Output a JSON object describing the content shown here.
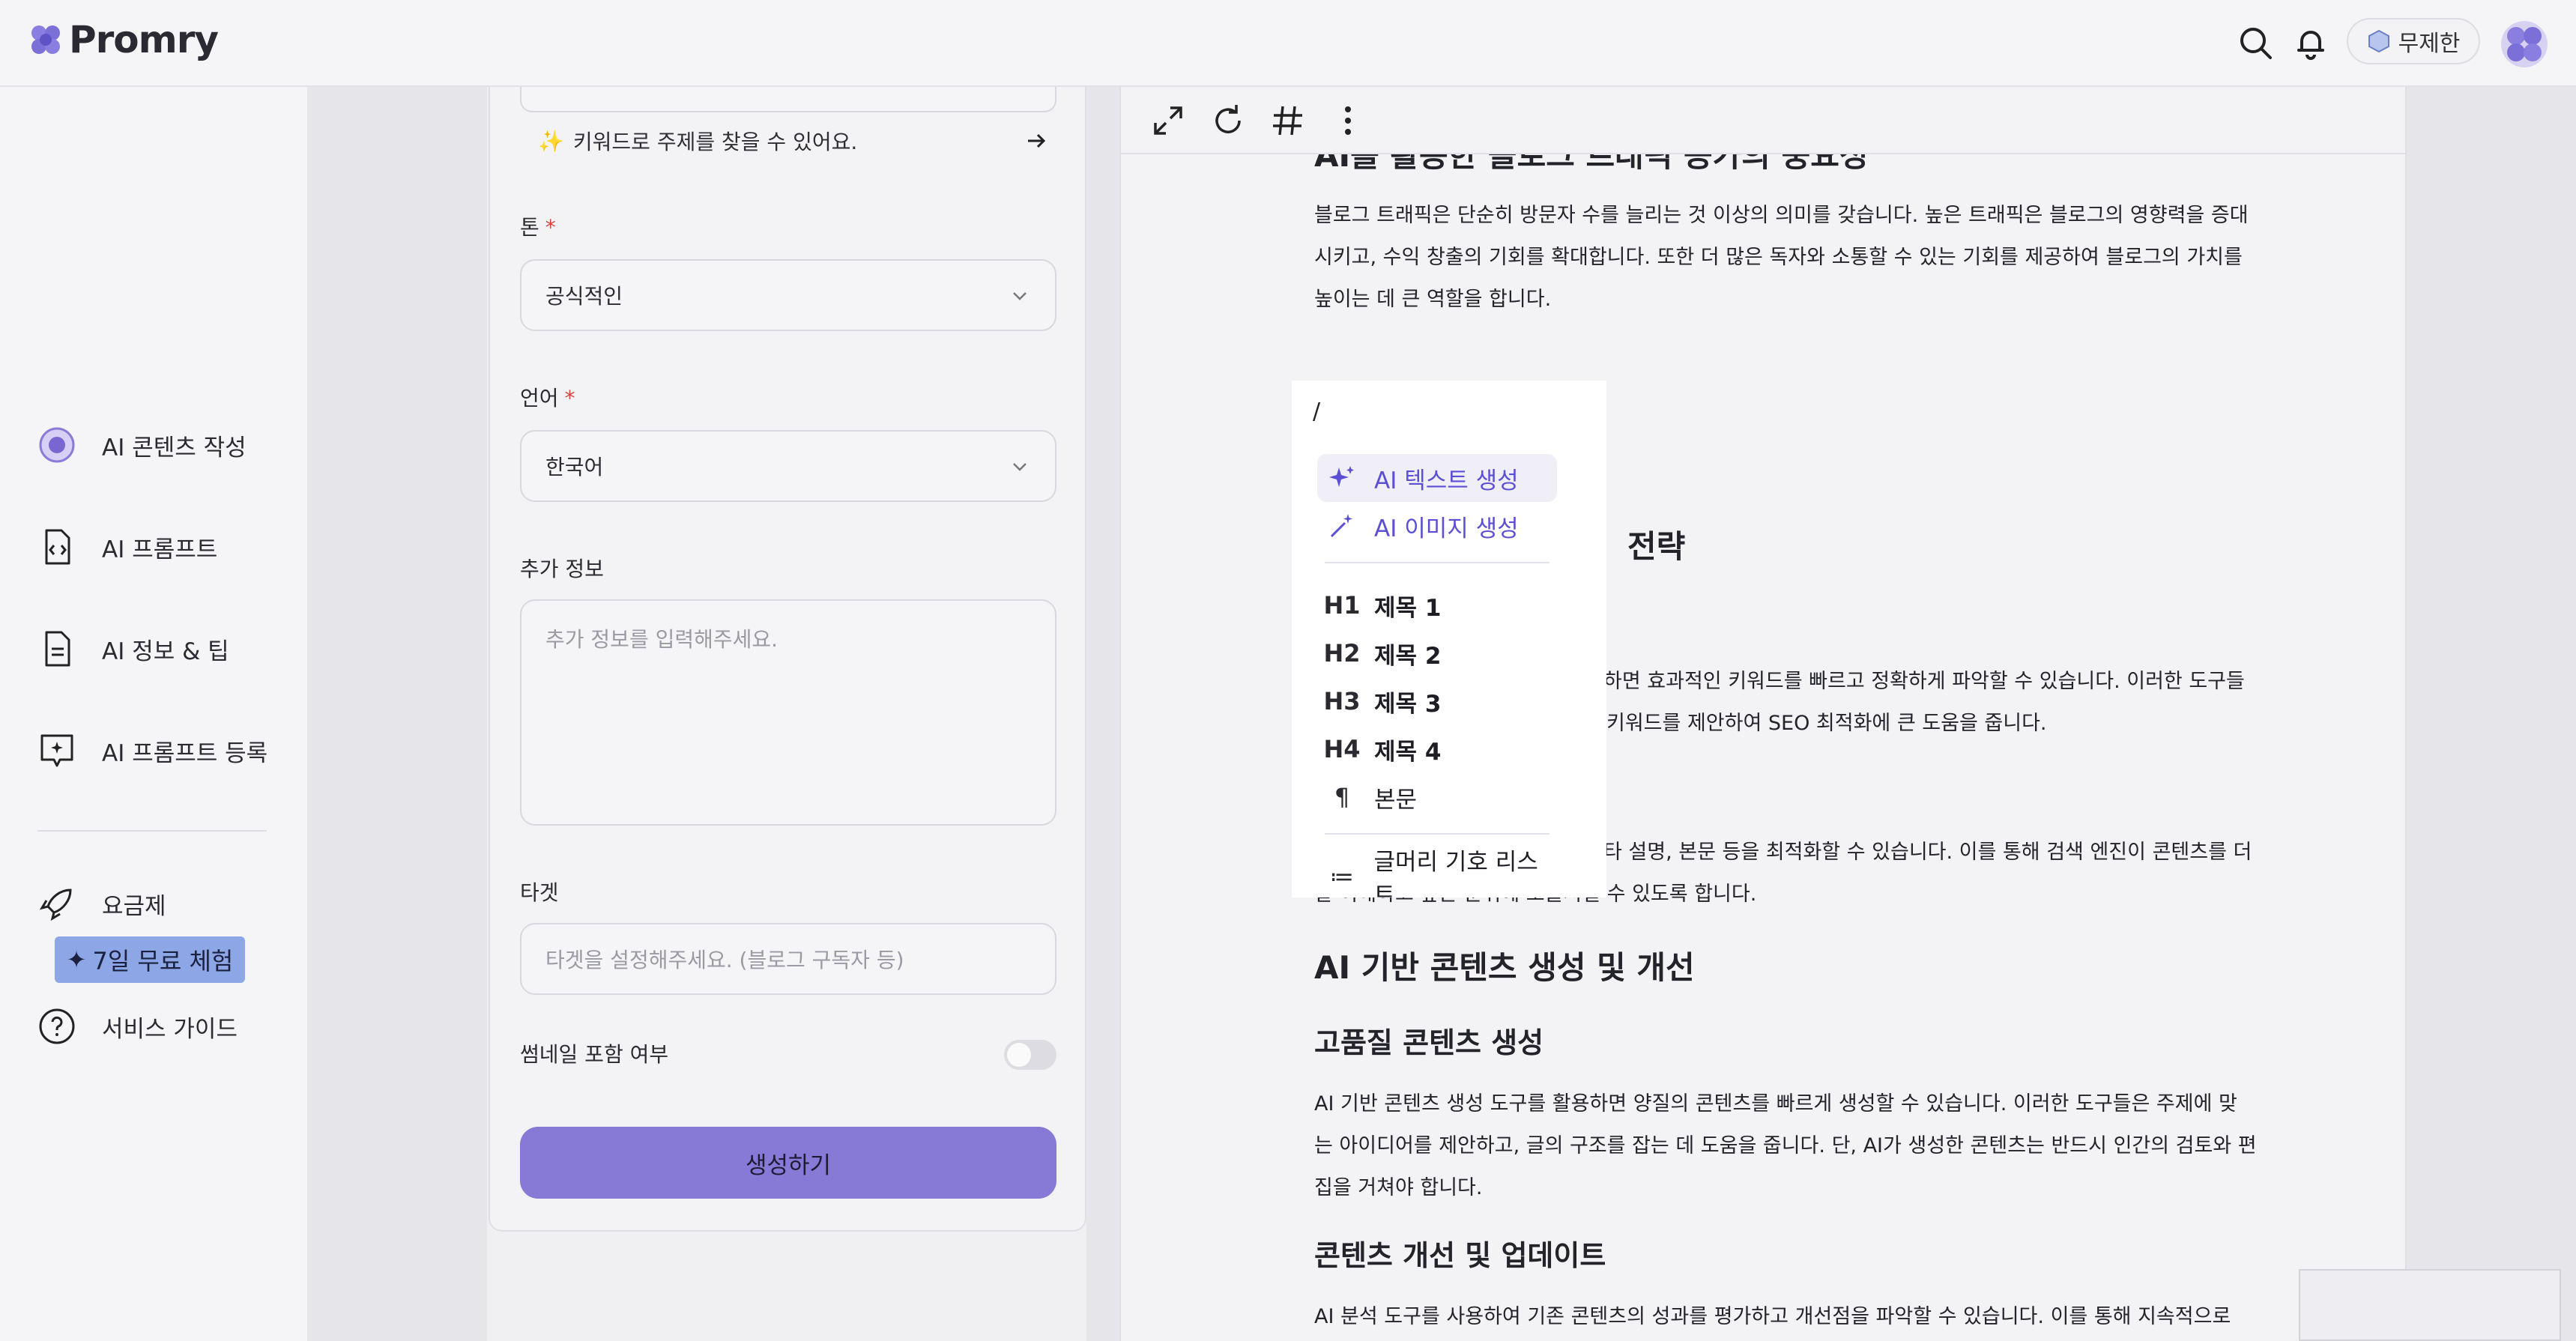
{
  "app": {
    "name": "Promry"
  },
  "header": {
    "plan_label": "무제한",
    "search_icon": "search-icon",
    "bell_icon": "bell-icon"
  },
  "sidebar": {
    "items": [
      {
        "label": "AI 콘텐츠 작성",
        "icon": "ai-content-icon"
      },
      {
        "label": "AI 프롬프트",
        "icon": "code-document-icon"
      },
      {
        "label": "AI 정보 & 팁",
        "icon": "document-icon"
      },
      {
        "label": "AI 프롬프트 등록",
        "icon": "chat-add-icon"
      },
      {
        "label": "요금제",
        "icon": "rocket-icon"
      },
      {
        "label": "서비스 가이드",
        "icon": "help-icon"
      }
    ],
    "trial_badge": "7일 무료 체험"
  },
  "form": {
    "keyword_hint": "키워드로 주제를 찾을 수 있어요.",
    "tone_label": "톤",
    "tone_value": "공식적인",
    "language_label": "언어",
    "language_value": "한국어",
    "extra_label": "추가 정보",
    "extra_placeholder": "추가 정보를 입력해주세요.",
    "target_label": "타겟",
    "target_placeholder": "타겟을 설정해주세요. (블로그 구독자 등)",
    "thumbnail_label": "썸네일 포함 여부",
    "thumbnail_enabled": false,
    "generate_button": "생성하기",
    "required_mark": "*"
  },
  "editor": {
    "heading_top": "AI를 활용한 블로그 트래픽 증가의 중요성",
    "para1": [
      "블로그 트래픽은 단순히 방문자 수를 늘리는 것 이상의 의미를 갖습니다. 높은 트래픽은 블로그의 영향력을 증대",
      "시키고, 수익 창출의 기회를 확대합니다. 또한 더 많은 독자와 소통할 수 있는 기회를 제공하여 블로그의 가치를",
      "높이는 데 큰 역할을 합니다."
    ],
    "heading_partial": "전략",
    "para2": [
      "하면 효과적인 키워드를 빠르고 정확하게 파악할 수 있습니다. 이러한 도구들",
      "키워드를 제안하여 SEO 최적화에 큰 도움을 줍니다."
    ],
    "para3": [
      "타 설명, 본문 등을 최적화할 수 있습니다. 이를 통해 검색 엔진이 콘텐츠를 더",
      "잘 이해하고 높은 순위에 노출시킬 수 있도록 합니다."
    ],
    "heading_ai": "AI 기반 콘텐츠 생성 및 개선",
    "sub_quality": "고품질 콘텐츠 생성",
    "para4": [
      "AI 기반 콘텐츠 생성 도구를 활용하면 양질의 콘텐츠를 빠르게 생성할 수 있습니다. 이러한 도구들은 주제에 맞",
      "는 아이디어를 제안하고, 글의 구조를 잡는 데 도움을 줍니다. 단, AI가 생성한 콘텐츠는 반드시 인간의 검토와 편",
      "집을 거쳐야 합니다."
    ],
    "sub_update": "콘텐츠 개선 및 업데이트",
    "para5": [
      "AI 분석 도구를 사용하여 기존 콘텐츠의 성과를 평가하고 개선점을 파악할 수 있습니다. 이를 통해 지속적으로"
    ]
  },
  "slash_menu": {
    "trigger": "/",
    "ai_items": [
      {
        "label": "AI 텍스트 생성",
        "icon": "sparkle-icon",
        "selected": true
      },
      {
        "label": "AI 이미지 생성",
        "icon": "magic-wand-icon",
        "selected": false
      }
    ],
    "format_items": [
      {
        "label": "제목 1",
        "glyph": "H1"
      },
      {
        "label": "제목 2",
        "glyph": "H2"
      },
      {
        "label": "제목 3",
        "glyph": "H3"
      },
      {
        "label": "제목 4",
        "glyph": "H4"
      },
      {
        "label": "본문",
        "glyph": "¶"
      },
      {
        "label": "글머리 기호 리스트",
        "glyph": "≔"
      }
    ]
  }
}
